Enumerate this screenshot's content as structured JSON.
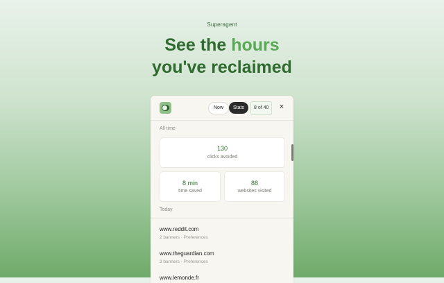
{
  "brand": "Superagent",
  "headline": {
    "line1_pre": "See the ",
    "line1_highlight": "hours",
    "line2": "you've reclaimed"
  },
  "panel": {
    "app_icon": "toggle-app-icon",
    "tabs": {
      "now": "Now",
      "stats": "Stats"
    },
    "counter": "8 of 40",
    "close_icon": "×",
    "all_time_label": "All time",
    "stats": {
      "clicks": {
        "value": "130",
        "label": "clicks avoided"
      },
      "time": {
        "value": "8 min",
        "label": "time saved"
      },
      "websites": {
        "value": "88",
        "label": "websites visited"
      }
    },
    "today_label": "Today",
    "sites": [
      {
        "domain": "www.reddit.com",
        "meta": "2 banners · Preferences"
      },
      {
        "domain": "www.theguardian.com",
        "meta": "3 banners · Preferences"
      },
      {
        "domain": "www.lemonde.fr",
        "meta": ""
      }
    ]
  },
  "colors": {
    "accent_green": "#5aa957",
    "dark_green": "#2f6a2f",
    "stats_button": "#2b2b2b"
  }
}
